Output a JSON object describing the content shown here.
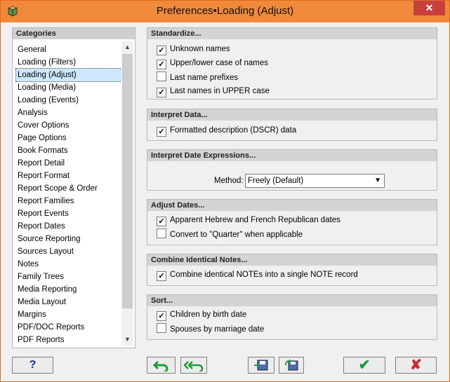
{
  "window": {
    "title": "Preferences•Loading (Adjust)",
    "close_glyph": "✕"
  },
  "categories": {
    "header": "Categories",
    "items": [
      {
        "label": "General"
      },
      {
        "label": "Loading (Filters)"
      },
      {
        "label": "Loading (Adjust)",
        "selected": true
      },
      {
        "label": "Loading (Media)"
      },
      {
        "label": "Loading (Events)"
      },
      {
        "label": "Analysis"
      },
      {
        "label": "Cover Options"
      },
      {
        "label": "Page Options"
      },
      {
        "label": "Book Formats"
      },
      {
        "label": "Report Detail"
      },
      {
        "label": "Report Format"
      },
      {
        "label": "Report Scope & Order"
      },
      {
        "label": "Report Families"
      },
      {
        "label": "Report Events"
      },
      {
        "label": "Report Dates"
      },
      {
        "label": "Source Reporting"
      },
      {
        "label": "Sources Layout"
      },
      {
        "label": "Notes"
      },
      {
        "label": "Family Trees"
      },
      {
        "label": "Media Reporting"
      },
      {
        "label": "Media Layout"
      },
      {
        "label": "Margins"
      },
      {
        "label": "PDF/DOC Reports"
      },
      {
        "label": "PDF Reports"
      }
    ]
  },
  "standardize": {
    "header": "Standardize...",
    "options": [
      {
        "label": "Unknown names",
        "checked": true
      },
      {
        "label": "Upper/lower case of names",
        "checked": true
      },
      {
        "label": "Last name prefixes",
        "checked": false
      },
      {
        "label": "Last names in UPPER case",
        "checked": true
      }
    ]
  },
  "interpret_data": {
    "header": "Interpret Data...",
    "options": [
      {
        "label": "Formatted description (DSCR) data",
        "checked": true
      }
    ]
  },
  "interpret_dates": {
    "header": "Interpret Date Expressions...",
    "method_label": "Method:",
    "method_value": "Freely (Default)"
  },
  "adjust_dates": {
    "header": "Adjust Dates...",
    "options": [
      {
        "label": "Apparent Hebrew and French Republican dates",
        "checked": true
      },
      {
        "label": "Convert to \"Quarter\" when applicable",
        "checked": false
      }
    ]
  },
  "combine_notes": {
    "header": "Combine Identical Notes...",
    "options": [
      {
        "label": "Combine identical NOTEs into a single NOTE record",
        "checked": true
      }
    ]
  },
  "sort": {
    "header": "Sort...",
    "options": [
      {
        "label": "Children by birth date",
        "checked": true
      },
      {
        "label": "Spouses by marriage date",
        "checked": false
      }
    ]
  },
  "buttons": {
    "help": "?",
    "ok_glyph": "✔",
    "cancel_glyph": "✘"
  },
  "colors": {
    "titlebar": "#f08a3a",
    "accent_green": "#1f9c3a",
    "cancel_red": "#d3262b",
    "help_blue": "#1a2fa8",
    "selection": "#cde8ff"
  }
}
